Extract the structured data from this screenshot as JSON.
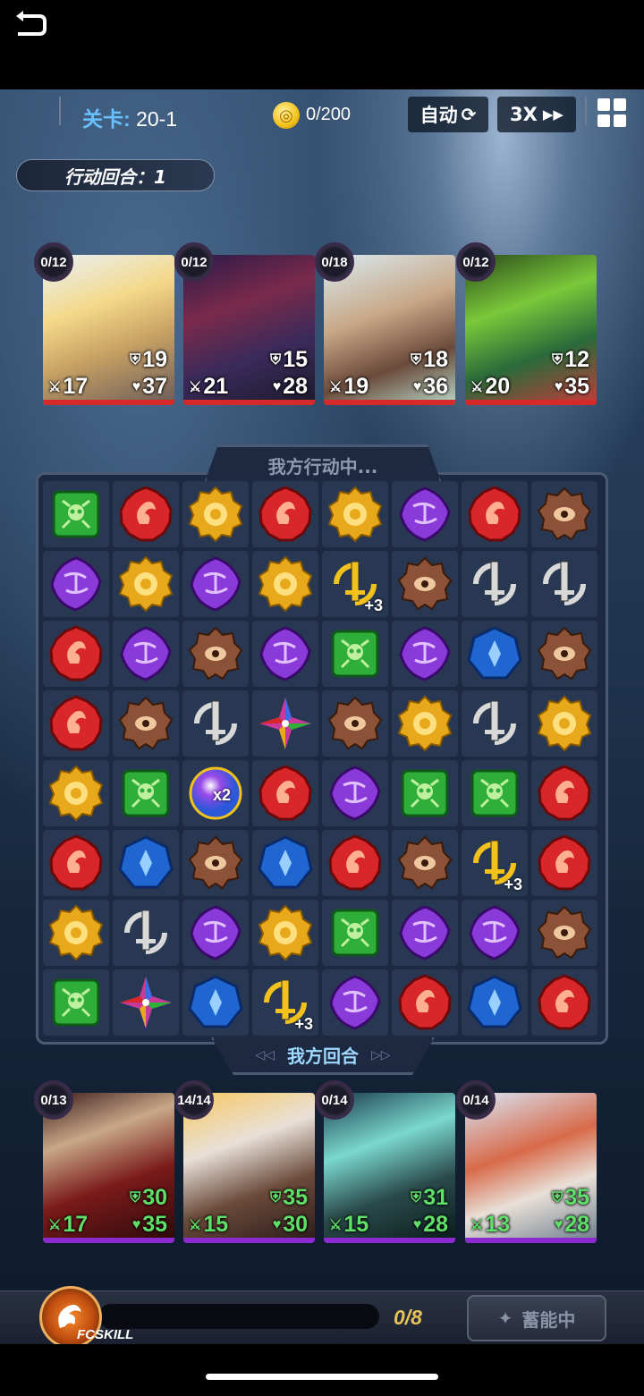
{
  "hud": {
    "stage_label": "关卡:",
    "stage_value": "20-1",
    "coin_value": "0/200",
    "auto_label": "自动",
    "speed_label": "3X",
    "turn_label": "行动回合：1"
  },
  "enemies": [
    {
      "energy": "0/12",
      "shield": "19",
      "attack": "17",
      "hp": "37"
    },
    {
      "energy": "0/12",
      "shield": "15",
      "attack": "21",
      "hp": "28"
    },
    {
      "energy": "0/18",
      "shield": "18",
      "attack": "19",
      "hp": "36"
    },
    {
      "energy": "0/12",
      "shield": "12",
      "attack": "20",
      "hp": "35"
    }
  ],
  "board": {
    "top_label": "我方行动中...",
    "bottom_label": "我方回合",
    "rows": [
      [
        "green",
        "red",
        "yellow",
        "red",
        "yellow",
        "purple",
        "red",
        "brown"
      ],
      [
        "purple",
        "yellow",
        "purple",
        "yellow",
        "sword+3",
        "brown",
        "sword",
        "sword"
      ],
      [
        "red",
        "purple",
        "brown",
        "purple",
        "green",
        "purple",
        "blue",
        "brown"
      ],
      [
        "red",
        "brown",
        "sword",
        "star",
        "brown",
        "yellow",
        "sword",
        "yellow"
      ],
      [
        "yellow",
        "green",
        "orbx2",
        "red",
        "purple",
        "green",
        "green",
        "red"
      ],
      [
        "red",
        "blue",
        "brown",
        "blue",
        "red",
        "brown",
        "sword+3",
        "red"
      ],
      [
        "yellow",
        "sword",
        "purple",
        "yellow",
        "green",
        "purple",
        "purple",
        "brown"
      ],
      [
        "green",
        "star",
        "blue",
        "sword+3",
        "purple",
        "red",
        "blue",
        "red"
      ]
    ],
    "badges": {
      "sword+3": "+3",
      "orbx2": "x2"
    }
  },
  "heroes": [
    {
      "energy": "0/13",
      "shield": "30",
      "attack": "17",
      "hp": "35"
    },
    {
      "energy": "14/14",
      "shield": "35",
      "attack": "15",
      "hp": "30"
    },
    {
      "energy": "0/14",
      "shield": "31",
      "attack": "15",
      "hp": "28"
    },
    {
      "energy": "0/14",
      "shield": "35",
      "attack": "13",
      "hp": "28"
    }
  ],
  "footer": {
    "fcskill_label": "FCSKILL",
    "fcskill_count": "0/8",
    "charge_label": "蓄能中"
  },
  "colors": {
    "red": "#d8262a",
    "yellow": "#e8a81c",
    "purple": "#8a3ad8",
    "green": "#2fae3a",
    "brown": "#8c5238",
    "blue": "#1f66d0",
    "stat_green": "#5fe068",
    "enemy_bar": "#d62a2a",
    "hero_bar": "#8a2ad0"
  }
}
